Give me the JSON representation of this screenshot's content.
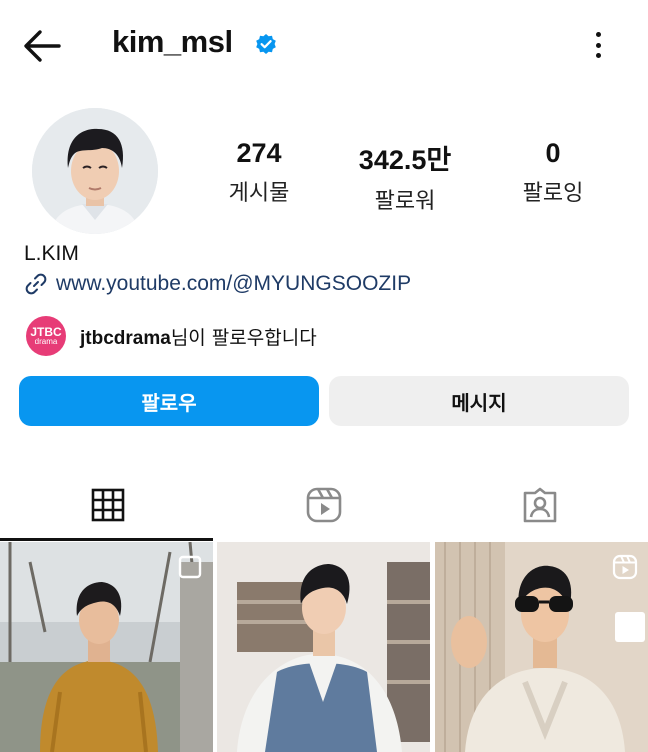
{
  "header": {
    "username": "kim_msl",
    "verified": true
  },
  "profile": {
    "stats": [
      {
        "value": "274",
        "label": "게시물"
      },
      {
        "value": "342.5만",
        "label": "팔로워"
      },
      {
        "value": "0",
        "label": "팔로잉"
      }
    ],
    "full_name": "L.KIM",
    "link": "www.youtube.com/@MYUNGSOOZIP",
    "followed_by": {
      "logo_line1": "JTBC",
      "logo_line2": "drama",
      "account": "jtbcdrama",
      "suffix": "님이 팔로우합니다"
    }
  },
  "actions": {
    "follow_label": "팔로우",
    "message_label": "메시지"
  },
  "tabs": [
    {
      "icon": "grid-icon",
      "selected": true
    },
    {
      "icon": "reels-icon",
      "selected": false
    },
    {
      "icon": "tagged-icon",
      "selected": false
    }
  ],
  "colors": {
    "primary": "#0896f0",
    "verified": "#0896f0",
    "jtbc": "#e73c77",
    "secondary_button": "#efefef"
  }
}
